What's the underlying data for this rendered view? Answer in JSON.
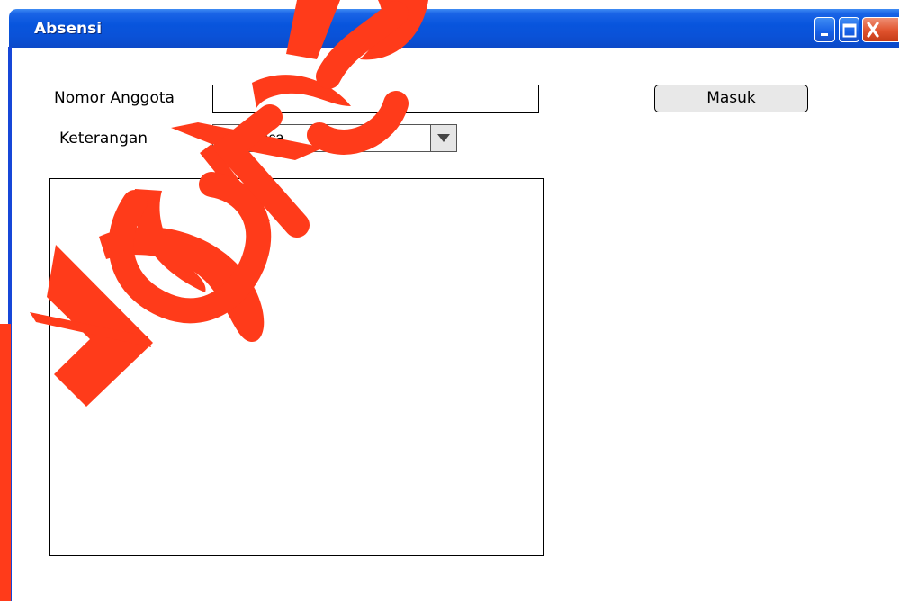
{
  "window": {
    "title": "Absensi"
  },
  "titlebar_buttons": {
    "minimize_icon": "minimize-icon",
    "maximize_icon": "maximize-icon",
    "close_icon": "close-icon"
  },
  "form": {
    "nomor_anggota_label": "Nomor Anggota",
    "nomor_anggota_value": "",
    "keterangan_label": "Keterangan",
    "keterangan_selected": "Membaca",
    "masuk_button": "Masuk"
  },
  "watermark": {
    "text": "STIKOMS",
    "color": "#ff3b1a"
  },
  "colors": {
    "titlebar": "#0855dd",
    "border": "#1747d8",
    "close": "#e0532d"
  }
}
